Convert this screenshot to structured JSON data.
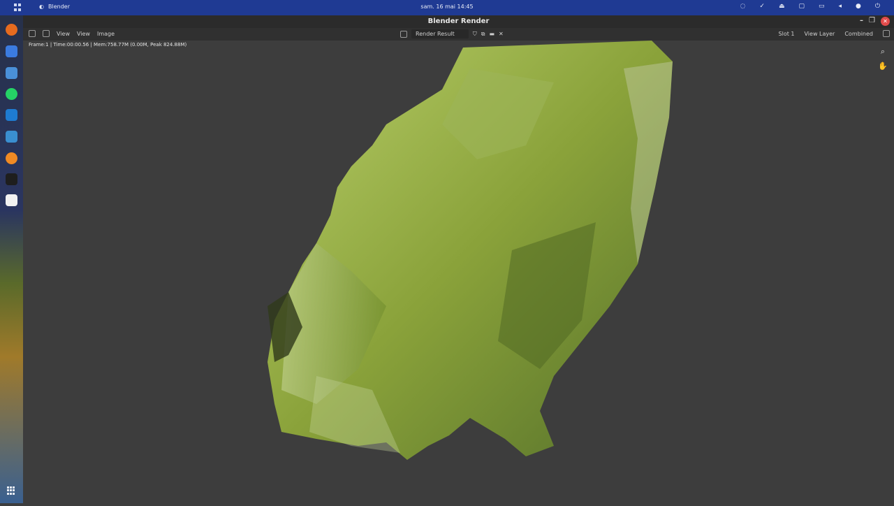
{
  "system": {
    "app_name": "Blender",
    "clock": "sam. 16 mai  14:45"
  },
  "window": {
    "title": "Blender Render"
  },
  "header": {
    "view_menu": "View",
    "view_menu2": "View",
    "image_menu": "Image",
    "image_name": "Render Result",
    "slot": "Slot 1",
    "view_layer": "View Layer",
    "pass": "Combined"
  },
  "stats": "Frame:1 | Time:00:00.56 | Mem:758.77M (0.00M, Peak 824.88M)",
  "colors": {
    "topbar": "#1f3a93",
    "viewport_bg": "#3d3d3d",
    "terrain": "#8aa23a"
  }
}
